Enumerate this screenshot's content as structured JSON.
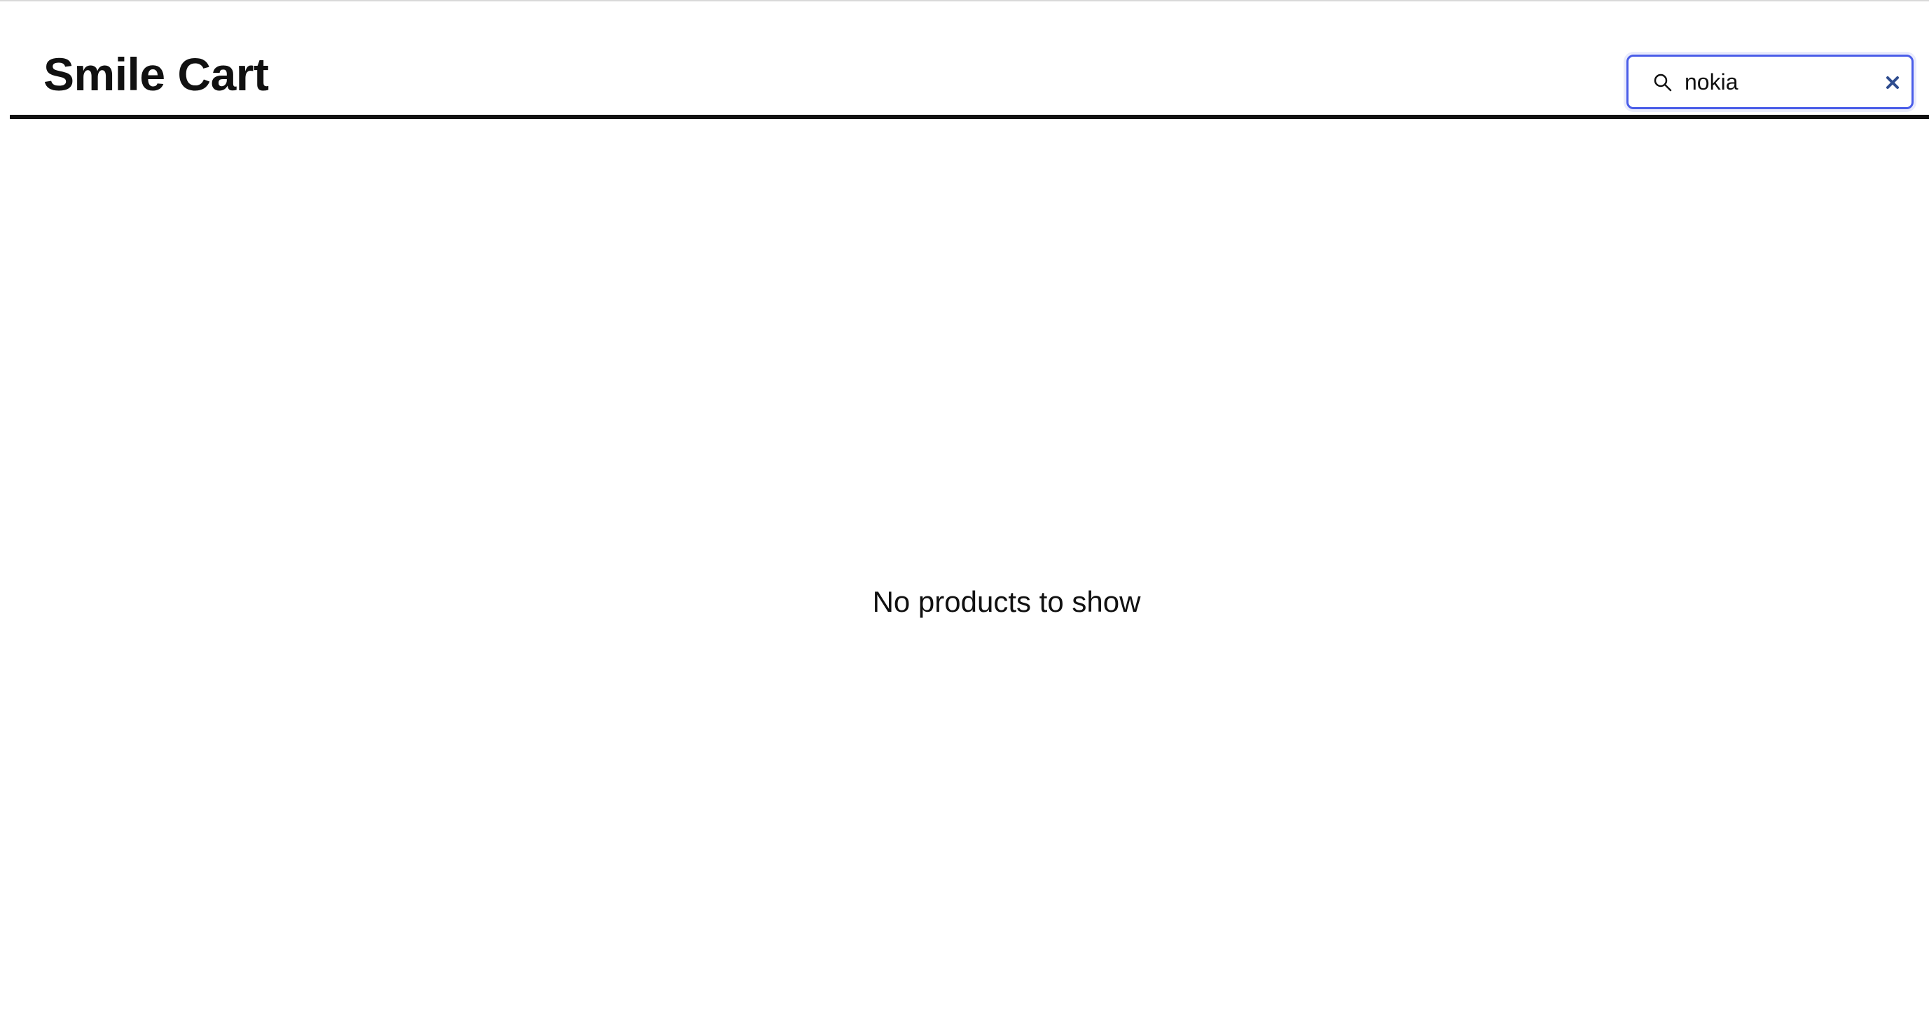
{
  "header": {
    "title": "Smile Cart"
  },
  "search": {
    "value": "nokia",
    "icon": "search-icon",
    "clear_icon": "close-icon",
    "focus_color": "#4a5de8"
  },
  "main": {
    "empty_message": "No products to show"
  },
  "colors": {
    "text": "#111111",
    "divider": "#111111",
    "clear_icon": "#2f4d8f"
  }
}
